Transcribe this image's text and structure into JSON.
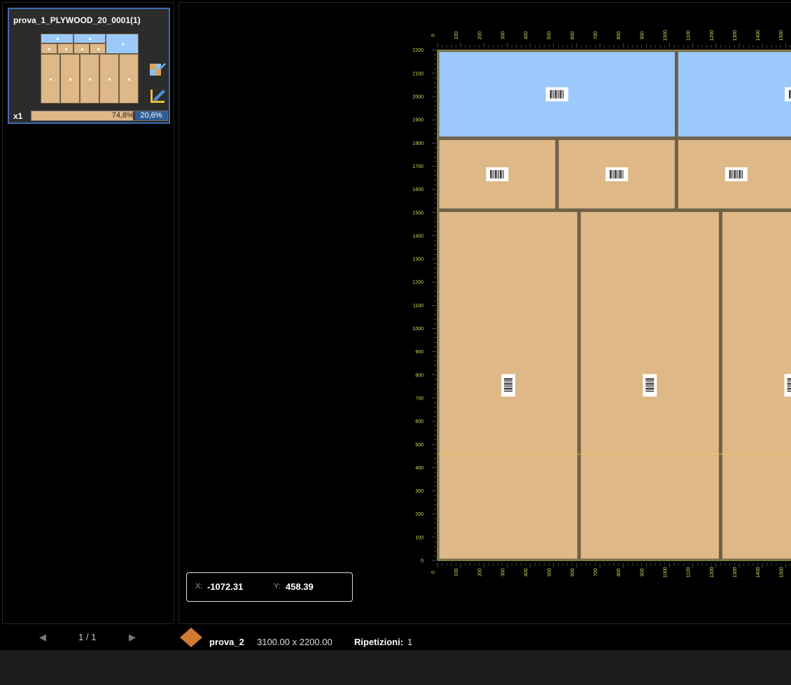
{
  "sheet_list": {
    "card_title": "prova_1_PLYWOOD_20_0001(1)",
    "quantity": "x1",
    "usage_pct": "74,8%",
    "waste_pct": "20,6%",
    "usage_fraction": 0.748,
    "icons": [
      "edit-parts-icon",
      "measure-tool-icon"
    ]
  },
  "pager": {
    "prev": "◀",
    "page": "1 / 1",
    "next": "▶"
  },
  "status": {
    "material_icon": "diamond-icon",
    "material_color": "#d07a32",
    "sheet_name": "prova_2",
    "dimensions": "3100.00 x 2200.00",
    "repetitions_label": "Ripetizioni:",
    "repetitions": "1"
  },
  "cursor": {
    "x_label": "X:",
    "x_value": "-1072.31",
    "y_label": "Y:",
    "y_value": "458.39"
  },
  "colors": {
    "part_tan": "#deb887",
    "part_blue": "#9cc9fb",
    "kerf": "#6e6148",
    "ruler_text": "#d8d85a",
    "selection_border": "#3e6bb5"
  },
  "ruler": {
    "x_ticks": [
      "0",
      "100",
      "200",
      "300",
      "400",
      "500",
      "600",
      "700",
      "800",
      "900",
      "1000",
      "1100",
      "1200",
      "1300",
      "1400",
      "1500"
    ],
    "y_ticks": [
      "0",
      "100",
      "200",
      "300",
      "400",
      "500",
      "600",
      "700",
      "800",
      "900",
      "1000",
      "1100",
      "1200",
      "1300",
      "1400",
      "1500",
      "1600",
      "1700",
      "1800",
      "1900",
      "2000",
      "2100",
      "2200"
    ]
  },
  "cutting_plan": {
    "sheet_length_mm": 3100,
    "sheet_width_mm": 2200,
    "cursor_y_mm": 458.39,
    "parts": [
      {
        "color": "blue",
        "x0": 0,
        "x1": 1030,
        "y0": 1820,
        "y1": 2200,
        "label": "barcode"
      },
      {
        "color": "blue",
        "x0": 1030,
        "x1": 2060,
        "y0": 1820,
        "y1": 2200,
        "label": "barcode"
      },
      {
        "color": "tan",
        "x0": 0,
        "x1": 515,
        "y0": 1510,
        "y1": 1820,
        "label": "barcode"
      },
      {
        "color": "tan",
        "x0": 515,
        "x1": 1030,
        "y0": 1510,
        "y1": 1820,
        "label": "barcode"
      },
      {
        "color": "tan",
        "x0": 1030,
        "x1": 1545,
        "y0": 1510,
        "y1": 1820,
        "label": "barcode"
      },
      {
        "color": "tan",
        "x0": 0,
        "x1": 610,
        "y0": 0,
        "y1": 1510,
        "label": "barcode"
      },
      {
        "color": "tan",
        "x0": 610,
        "x1": 1220,
        "y0": 0,
        "y1": 1510,
        "label": "barcode"
      },
      {
        "color": "tan",
        "x0": 1220,
        "x1": 1830,
        "y0": 0,
        "y1": 1510,
        "label": "barcode"
      }
    ]
  }
}
